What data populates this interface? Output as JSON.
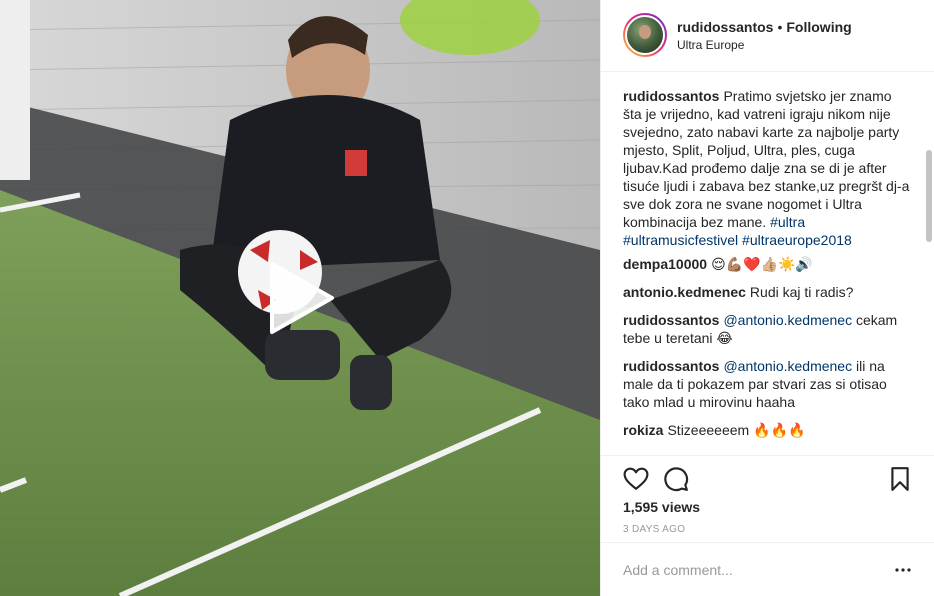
{
  "header": {
    "username": "rudidossantos",
    "separator": "•",
    "follow_state": "Following",
    "location": "Ultra Europe"
  },
  "caption": {
    "username": "rudidossantos",
    "text": "Pratimo svjetsko jer znamo šta je vrijedno, kad vatreni igraju nikom nije svejedno, zato nabavi karte za najbolje party mjesto, Split, Poljud, Ultra, ples, cuga ljubav.Kad prođemo dalje zna se di je after tisuće ljudi i zabava bez stanke,uz pregršt dj-a sve dok zora ne svane nogomet i Ultra kombinacija bez mane. ",
    "hashtags": [
      "#ultra",
      "#ultramusicfestivel",
      "#ultraeurope2018"
    ]
  },
  "comments": [
    {
      "username": "dempa10000",
      "text": "😌💪🏽❤️👍🏼☀️🔊"
    },
    {
      "username": "antonio.kedmenec",
      "text": "Rudi kaj ti radis?"
    },
    {
      "username": "rudidossantos",
      "mention": "@antonio.kedmenec",
      "text": "cekam tebe u teretani 😂"
    },
    {
      "username": "rudidossantos",
      "mention": "@antonio.kedmenec",
      "text": "ili na male da ti pokazem par stvari zas si otisao tako mlad u mirovinu haaha"
    },
    {
      "username": "rokiza",
      "text": "Stizeeeeeem 🔥🔥🔥"
    }
  ],
  "icons": {
    "like": "heart-icon",
    "comment": "comment-icon",
    "save": "bookmark-icon",
    "more": "more-options-icon",
    "play": "play-icon"
  },
  "stats": {
    "views": "1,595 views",
    "time_ago": "3 DAYS AGO"
  },
  "add_comment": {
    "placeholder": "Add a comment..."
  },
  "colors": {
    "text": "#262626",
    "link": "#003569",
    "muted": "#999999",
    "divider": "#efefef"
  }
}
